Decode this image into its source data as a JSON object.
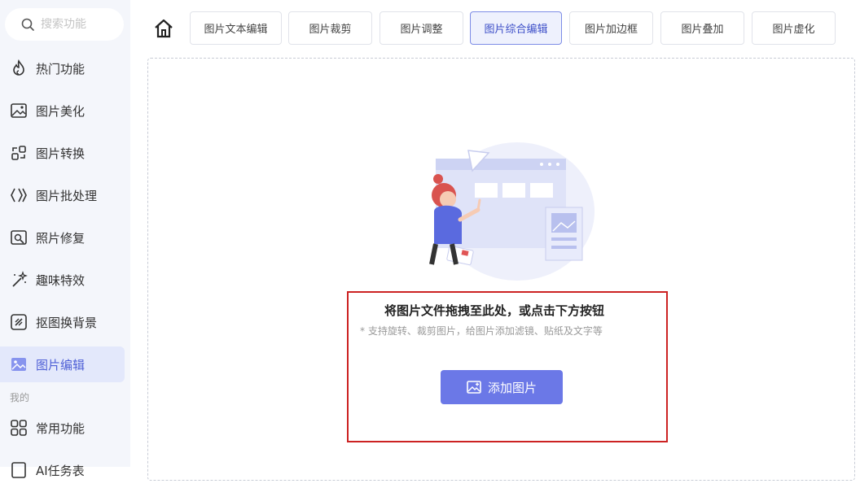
{
  "sidebar": {
    "search_placeholder": "搜索功能",
    "items": [
      {
        "label": "热门功能",
        "icon": "fire-icon"
      },
      {
        "label": "图片美化",
        "icon": "image-edit-icon"
      },
      {
        "label": "图片转换",
        "icon": "convert-icon"
      },
      {
        "label": "图片批处理",
        "icon": "batch-icon"
      },
      {
        "label": "照片修复",
        "icon": "photo-repair-icon"
      },
      {
        "label": "趣味特效",
        "icon": "magic-wand-icon"
      },
      {
        "label": "抠图换背景",
        "icon": "cutout-icon"
      },
      {
        "label": "图片编辑",
        "icon": "image-icon",
        "active": true
      }
    ],
    "section_label": "我的",
    "my_items": [
      {
        "label": "常用功能",
        "icon": "grid-icon"
      },
      {
        "label": "AI任务表",
        "icon": "task-icon"
      }
    ]
  },
  "tabs": [
    {
      "label": "图片文本编辑"
    },
    {
      "label": "图片裁剪"
    },
    {
      "label": "图片调整"
    },
    {
      "label": "图片综合编辑",
      "active": true
    },
    {
      "label": "图片加边框"
    },
    {
      "label": "图片叠加"
    },
    {
      "label": "图片虚化"
    }
  ],
  "dropzone": {
    "title": "将图片文件拖拽至此处，或点击下方按钮",
    "hint": "* 支持旋转、裁剪图片，给图片添加滤镜、贴纸及文字等",
    "button_label": "添加图片"
  },
  "colors": {
    "accent": "#6b78e7",
    "sidebar_bg": "#f4f6fb",
    "active_bg": "#e3e8fb",
    "highlight": "#cc2222"
  }
}
